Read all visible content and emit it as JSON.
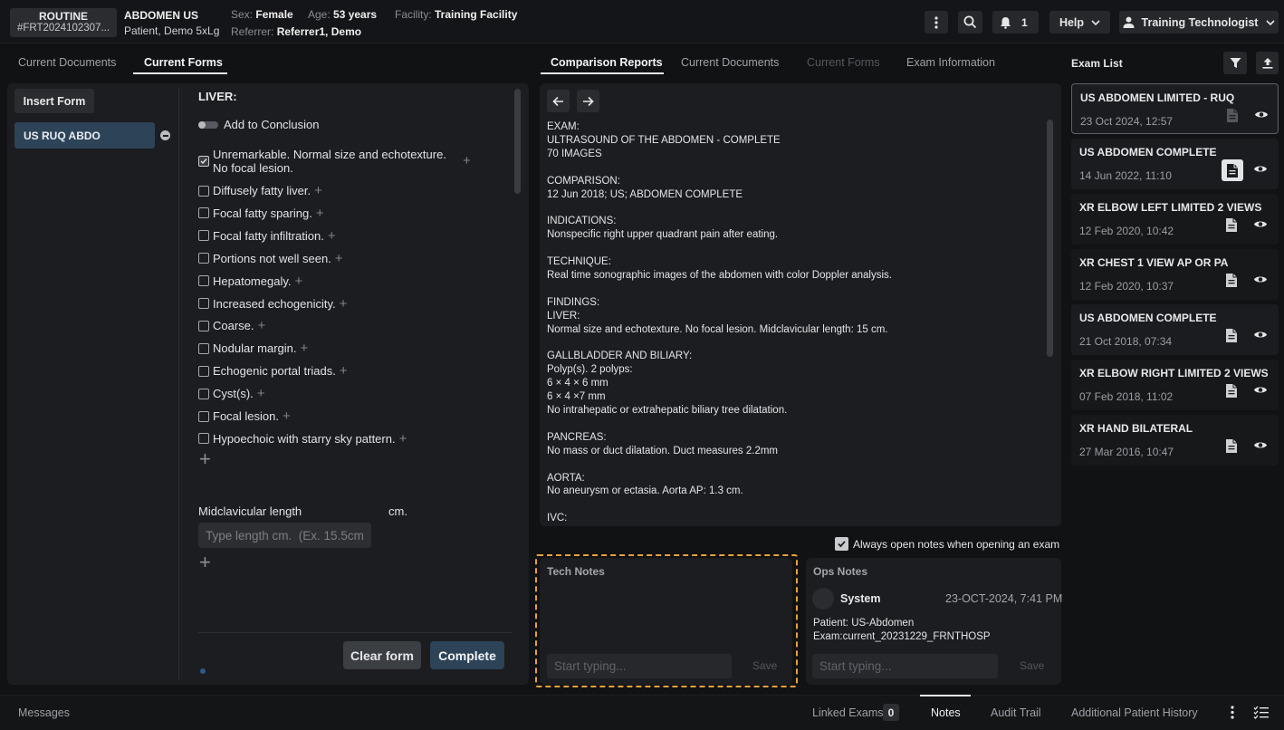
{
  "header": {
    "priority": "ROUTINE",
    "accession": "#FRT2024102307...",
    "exam_title": "ABDOMEN US",
    "patient_name": "Patient, Demo 5xLg",
    "sex_label": "Sex:",
    "sex": "Female",
    "age_label": "Age:",
    "age": "53 years",
    "facility_label": "Facility:",
    "facility": "Training Facility",
    "referrer_label": "Referrer:",
    "referrer": "Referrer1, Demo",
    "notification_count": "1",
    "help_label": "Help",
    "user_label": "Training Technologist"
  },
  "left_panel": {
    "tabs": [
      "Current Documents",
      "Current Forms"
    ],
    "insert_form_label": "Insert Form",
    "form_entry": "US RUQ ABDO",
    "section_title": "LIVER:",
    "add_to_conclusion": "Add to Conclusion",
    "first_item_line1": "Unremarkable. Normal size and echotexture.",
    "first_item_line2": "No focal lesion.",
    "items": [
      "Diffusely fatty liver.",
      "Focal fatty sparing.",
      "Focal fatty infiltration.",
      "Portions not well seen.",
      "Hepatomegaly.",
      "Increased echogenicity.",
      "Coarse.",
      "Nodular margin.",
      "Echogenic portal triads.",
      "Cyst(s).",
      "Focal lesion.",
      "Hypoechoic with starry sky pattern."
    ],
    "midclavicular_label": "Midclavicular length",
    "unit": "cm.",
    "length_placeholder": "Type length cm.  (Ex. 15.5cm)",
    "clear_form": "Clear form",
    "complete": "Complete"
  },
  "center_panel": {
    "tabs": [
      "Comparison Reports",
      "Current Documents",
      "Current Forms",
      "Exam Information"
    ],
    "report_text": "EXAM:\nULTRASOUND OF THE ABDOMEN - COMPLETE\n70 IMAGES\n\nCOMPARISON:\n12 Jun 2018; US; ABDOMEN COMPLETE\n\nINDICATIONS:\nNonspecific right upper quadrant pain after eating.\n\nTECHNIQUE:\nReal time sonographic images of the abdomen with color Doppler analysis.\n\nFINDINGS:\nLIVER:\nNormal size and echotexture. No focal lesion. Midclavicular length: 15 cm.\n\nGALLBLADDER AND BILIARY:\nPolyp(s). 2 polyps:\n6 × 4 × 6 mm\n6 × 4 ×7 mm\nNo intrahepatic or extrahepatic biliary tree dilatation.\n\nPANCREAS:\nNo mass or duct dilatation. Duct measures 2.2mm\n\nAORTA:\nNo aneurysm or ectasia. Aorta AP: 1.3 cm.\n\nIVC:",
    "always_open_label": "Always open notes when opening an exam"
  },
  "tech_notes": {
    "title": "Tech Notes",
    "placeholder": "Start typing...",
    "save": "Save"
  },
  "ops_notes": {
    "title": "Ops Notes",
    "author": "System",
    "timestamp": "23-OCT-2024, 7:41 PM",
    "line1": "Patient: US-Abdomen",
    "line2": "Exam:current_20231229_FRNTHOSP",
    "placeholder": "Start typing...",
    "save": "Save"
  },
  "exam_list": {
    "title": "Exam List",
    "exams": [
      {
        "title": "US ABDOMEN LIMITED - RUQ",
        "date": "23 Oct 2024, 12:57"
      },
      {
        "title": "US ABDOMEN COMPLETE",
        "date": "14 Jun 2022, 11:10"
      },
      {
        "title": "XR ELBOW LEFT LIMITED 2 VIEWS",
        "date": "12 Feb 2020, 10:42"
      },
      {
        "title": "XR CHEST 1 VIEW AP OR PA",
        "date": "12 Feb 2020, 10:37"
      },
      {
        "title": "US ABDOMEN COMPLETE",
        "date": "21 Oct 2018, 07:34"
      },
      {
        "title": "XR ELBOW RIGHT LIMITED 2 VIEWS",
        "date": "07 Feb 2018, 11:02"
      },
      {
        "title": "XR HAND BILATERAL",
        "date": "27 Mar 2016, 10:47"
      }
    ]
  },
  "bottom_bar": {
    "messages": "Messages",
    "linked_exams": "Linked Exams",
    "linked_count": "0",
    "notes": "Notes",
    "audit_trail": "Audit Trail",
    "additional_history": "Additional Patient History"
  },
  "colors": {
    "background": "#111214",
    "panel": "#1c1d20",
    "accent_blue": "#2d4358",
    "highlight_orange": "#e8a23a"
  }
}
